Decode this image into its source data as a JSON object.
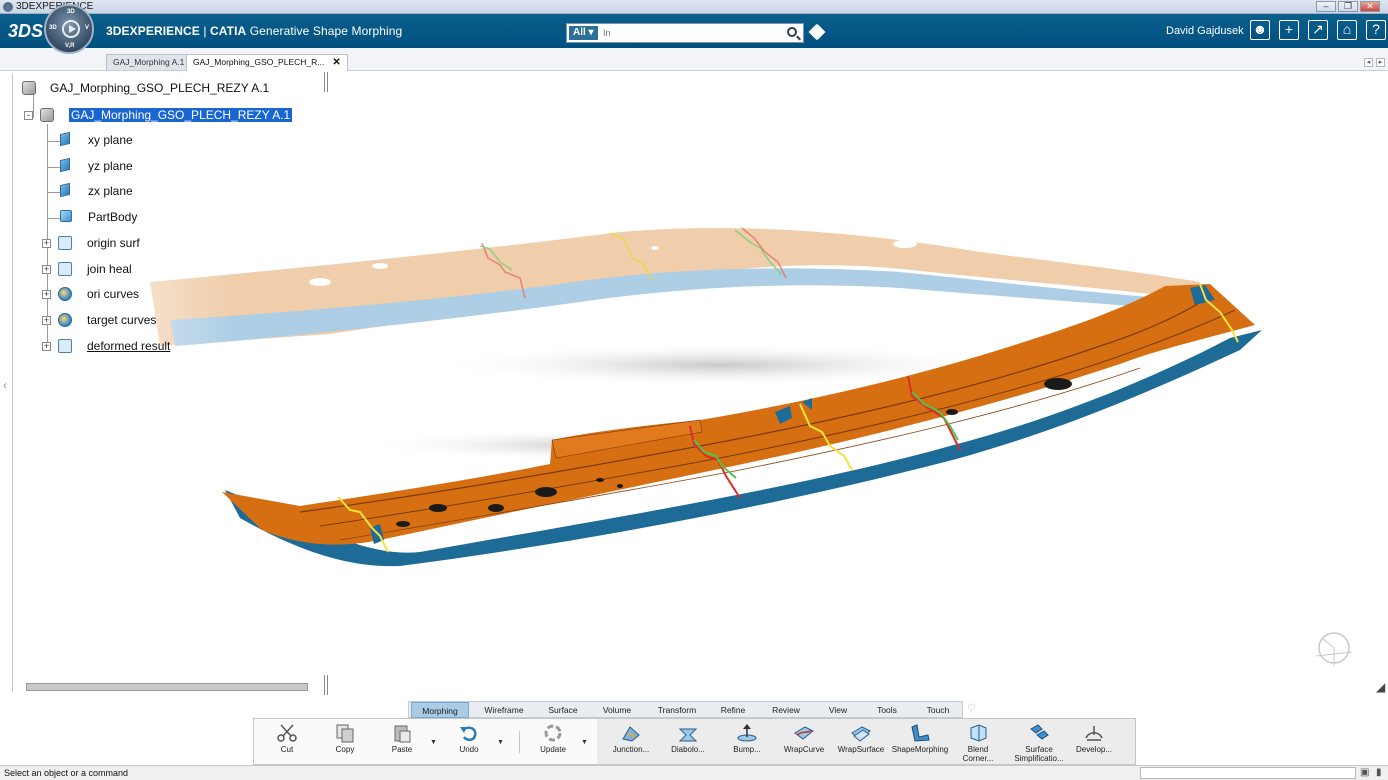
{
  "os": {
    "title": "3DEXPERIENCE"
  },
  "header": {
    "brand": "3DEXPERIENCE",
    "separator": " | ",
    "product": "CATIA",
    "app_name": "Generative Shape Morphing",
    "logo_text": "3DS",
    "compass_labels": {
      "top": "3D",
      "left": "3D",
      "right": "V",
      "bottom": "V,R"
    },
    "search_scope": "All",
    "search_placeholder": "In",
    "user": "David Gajdusek"
  },
  "tabs": [
    {
      "label": "GAJ_Morphing A.1",
      "active": false
    },
    {
      "label": "GAJ_Morphing_GSO_PLECH_R...",
      "active": true
    }
  ],
  "tree": {
    "root": "GAJ_Morphing_GSO_PLECH_REZY A.1",
    "part": "GAJ_Morphing_GSO_PLECH_REZY A.1",
    "children": [
      {
        "label": "xy plane",
        "icon": "plane-icon",
        "expandable": false
      },
      {
        "label": "yz plane",
        "icon": "plane-icon",
        "expandable": false
      },
      {
        "label": "zx plane",
        "icon": "plane-icon",
        "expandable": false
      },
      {
        "label": "PartBody",
        "icon": "partbody-icon",
        "expandable": false
      },
      {
        "label": "origin surf",
        "icon": "geometrical-set-icon",
        "expandable": true
      },
      {
        "label": "join heal",
        "icon": "geometrical-set-icon",
        "expandable": true
      },
      {
        "label": "ori curves",
        "icon": "curves-set-icon",
        "expandable": true
      },
      {
        "label": "target curves",
        "icon": "curves-set-icon",
        "expandable": true
      },
      {
        "label": "deformed result",
        "icon": "geometrical-set-icon",
        "expandable": true
      }
    ]
  },
  "action_bar": {
    "tabs": [
      "Morphing",
      "Wireframe",
      "Surface",
      "Volume",
      "Transform",
      "Refine",
      "Review",
      "View",
      "Tools",
      "Touch"
    ],
    "active_tab": "Morphing",
    "commands": [
      {
        "label": "Cut",
        "icon": "scissors-icon"
      },
      {
        "label": "Copy",
        "icon": "copy-icon"
      },
      {
        "label": "Paste",
        "icon": "paste-icon"
      },
      {
        "label": "Undo",
        "icon": "undo-icon"
      },
      {
        "label": "Update",
        "icon": "update-icon"
      },
      {
        "label": "Junction...",
        "icon": "junction-icon"
      },
      {
        "label": "Diabolo...",
        "icon": "diabolo-icon"
      },
      {
        "label": "Bump...",
        "icon": "bump-icon"
      },
      {
        "label": "WrapCurve",
        "icon": "wrapcurve-icon"
      },
      {
        "label": "WrapSurface",
        "icon": "wrapsurface-icon"
      },
      {
        "label": "ShapeMorphing",
        "icon": "shapemorphing-icon"
      },
      {
        "label": "Blend Corner...",
        "icon": "blend-corner-icon"
      },
      {
        "label": "Surface Simplificatio...",
        "icon": "surface-simplification-icon"
      },
      {
        "label": "Develop...",
        "icon": "develop-icon"
      }
    ]
  },
  "status": {
    "text": "Select an object or a command"
  },
  "colors": {
    "header_blue": "#00507e",
    "part_orange": "#d96f10",
    "part_blue": "#1f6f9a",
    "selection_blue": "#1a66d0",
    "curve_yellow": "#f4e23c",
    "curve_red": "#e02b2b",
    "curve_green": "#52c24a"
  }
}
